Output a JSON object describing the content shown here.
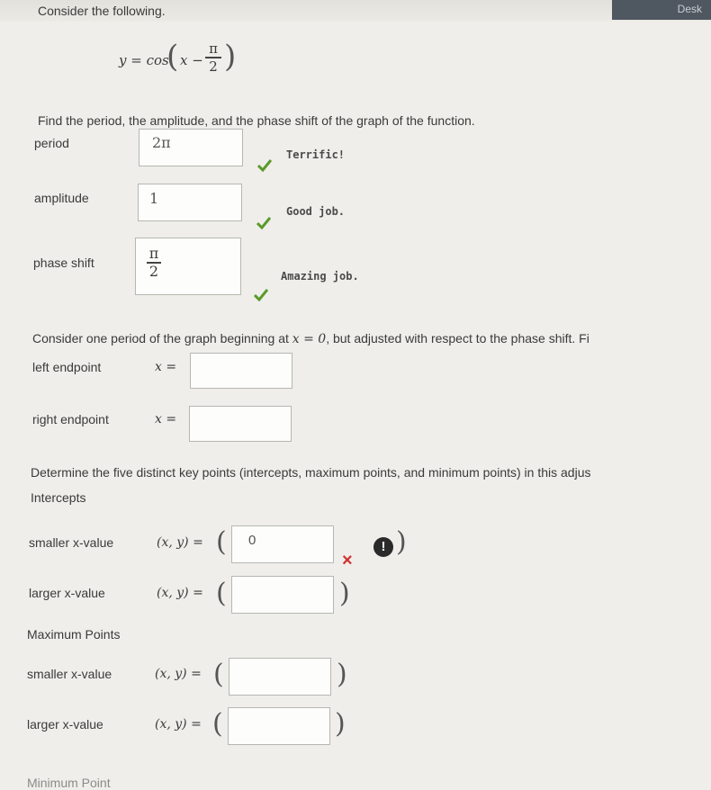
{
  "header": {
    "corner_label": "Desk"
  },
  "prompt": {
    "intro": "Consider the following.",
    "equation": {
      "lhs": "y = cos",
      "arg": "x −",
      "frac_num": "π",
      "frac_den": "2"
    },
    "instruction": "Find the period, the amplitude, and the phase shift of the graph of the function."
  },
  "answers": [
    {
      "label": "period",
      "value": "2π",
      "feedback": "Terrific!"
    },
    {
      "label": "amplitude",
      "value": "1",
      "feedback": "Good job."
    },
    {
      "label": "phase shift",
      "value_num": "π",
      "value_den": "2",
      "feedback": "Amazing job."
    }
  ],
  "period_section": {
    "text_before": "Consider one period of the graph beginning at ",
    "text_math": "x = 0",
    "text_after": ", but adjusted with respect to the phase shift. Fi",
    "left_label": "left endpoint",
    "right_label": "right endpoint",
    "x_eq": "x ="
  },
  "key_points": {
    "instruction": "Determine the five distinct key points (intercepts, maximum points, and minimum points) in this adjus",
    "intercepts_heading": "Intercepts",
    "smaller_label": "smaller x-value",
    "larger_label": "larger x-value",
    "xy_eq": "(x, y) =",
    "intercept_smaller_value": "0",
    "maximum_heading": "Maximum Points",
    "minimum_heading": "Minimum Point"
  },
  "colors": {
    "check": "#5a9a2a",
    "error": "#d03030",
    "box_border": "#b7b7b2"
  }
}
